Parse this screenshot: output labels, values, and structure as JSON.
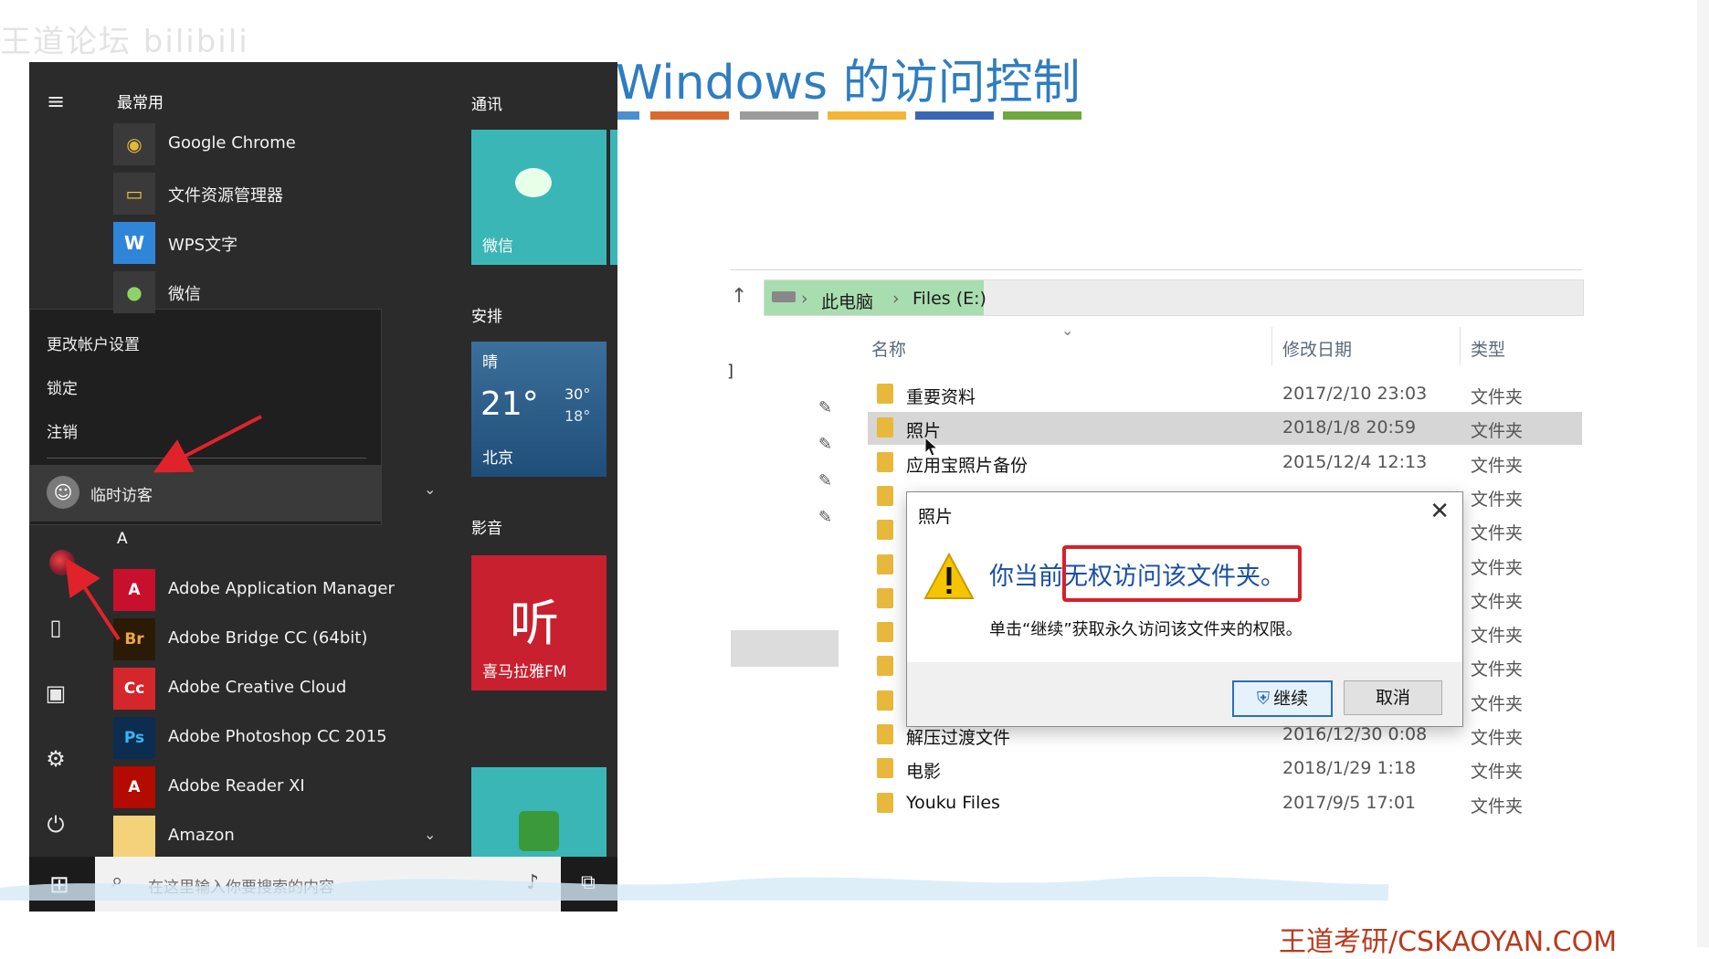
{
  "watermark": "王道论坛 bilibili",
  "slide": {
    "title": "Windows 的访问控制",
    "bar_colors": [
      "#4a8fd0",
      "#d9692f",
      "#9b9b9b",
      "#f2b534",
      "#3a67b5",
      "#6fa83e"
    ]
  },
  "start_menu": {
    "most_used_header": "最常用",
    "most_used": [
      {
        "label": "Google Chrome",
        "icon": "chrome-icon",
        "bg": "#3a3a3a"
      },
      {
        "label": "文件资源管理器",
        "icon": "folder-icon",
        "bg": "#3a3a3a"
      },
      {
        "label": "WPS文字",
        "icon": "wps-icon",
        "bg": "#2f86d9"
      },
      {
        "label": "微信",
        "icon": "wechat-icon",
        "bg": "#3a3a3a"
      }
    ],
    "account_menu": {
      "items": [
        "更改帐户设置",
        "锁定",
        "注销"
      ],
      "user": "临时访客"
    },
    "letter_a": "A",
    "a_apps": [
      {
        "label": "Adobe Application Manager",
        "glyph": "A",
        "bg": "#c8102e"
      },
      {
        "label": "Adobe Bridge CC (64bit)",
        "glyph": "Br",
        "bg": "#2b1b06"
      },
      {
        "label": "Adobe Creative Cloud",
        "glyph": "Cc",
        "bg": "#d4262b"
      },
      {
        "label": "Adobe Photoshop CC 2015",
        "glyph": "Ps",
        "bg": "#0c2d4f"
      },
      {
        "label": "Adobe Reader XI",
        "glyph": "A",
        "bg": "#b30b00"
      },
      {
        "label": "Amazon",
        "glyph": "",
        "bg": "#f4d27a"
      }
    ],
    "tile_groups": {
      "comm": "通讯",
      "schedule": "安排",
      "media": "影音"
    },
    "tiles": {
      "wechat": "微信",
      "weather": {
        "condition": "晴",
        "temp": "21°",
        "high": "30°",
        "low": "18°",
        "city": "北京"
      },
      "ximalaya_glyph": "听",
      "ximalaya": "喜马拉雅FM"
    },
    "search_placeholder": "在这里输入你要搜索的内容"
  },
  "explorer": {
    "breadcrumb": [
      "此电脑",
      "Files (E:)"
    ],
    "columns": {
      "name": "名称",
      "date": "修改日期",
      "type": "类型"
    },
    "rows": [
      {
        "name": "重要资料",
        "date": "2017/2/10 23:03",
        "type": "文件夹"
      },
      {
        "name": "照片",
        "date": "2018/1/8 20:59",
        "type": "文件夹"
      },
      {
        "name": "应用宝照片备份",
        "date": "2015/12/4 12:13",
        "type": "文件夹"
      },
      {
        "name": "",
        "date": "",
        "type": "文件夹"
      },
      {
        "name": "",
        "date": "",
        "type": "文件夹"
      },
      {
        "name": "",
        "date": "",
        "type": "文件夹"
      },
      {
        "name": "",
        "date": "",
        "type": "文件夹"
      },
      {
        "name": "",
        "date": "",
        "type": "文件夹"
      },
      {
        "name": "",
        "date": "",
        "type": "文件夹"
      },
      {
        "name": "",
        "date": "",
        "type": "文件夹"
      },
      {
        "name": "解压过渡文件",
        "date": "2016/12/30 0:08",
        "type": "文件夹"
      },
      {
        "name": "电影",
        "date": "2018/1/29 1:18",
        "type": "文件夹"
      },
      {
        "name": "Youku Files",
        "date": "2017/9/5 17:01",
        "type": "文件夹"
      }
    ]
  },
  "dialog": {
    "title": "照片",
    "message_prefix": "你当前",
    "message_highlight": "无权访问该文件夹。",
    "sub": "单击“继续”获取永久访问该文件夹的权限。",
    "continue": "继续",
    "cancel": "取消"
  },
  "footer_brand": "王道考研/CSKAOYAN.COM"
}
